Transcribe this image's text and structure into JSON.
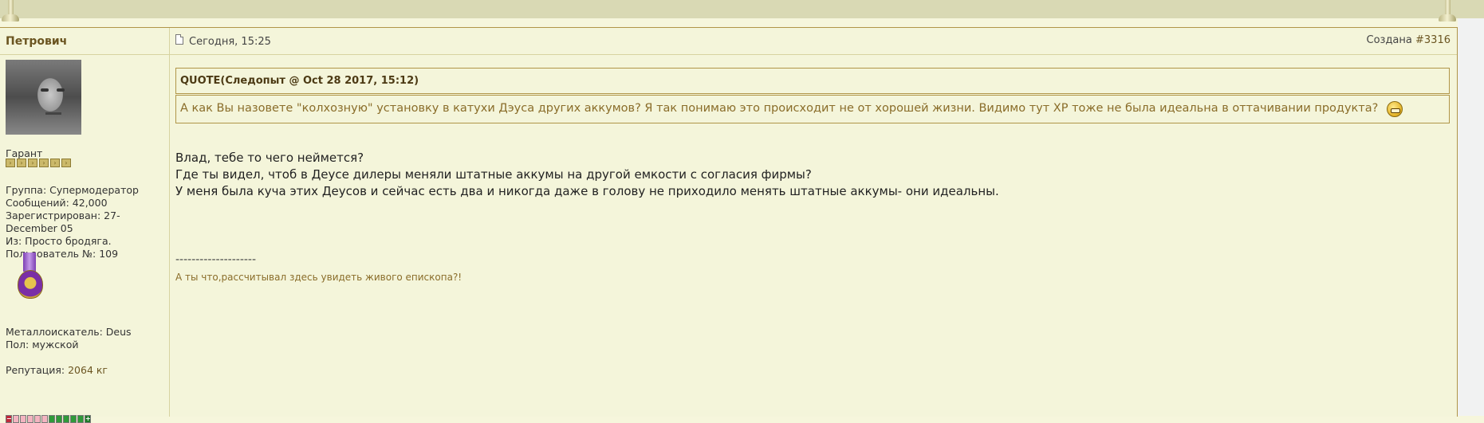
{
  "colors": {
    "background": "#f6f6dc",
    "border": "#b09548",
    "author_name": "#6b5521",
    "quote_text": "#8a6d2a"
  },
  "post": {
    "author": "Петрович",
    "date": "Сегодня, 15:25",
    "created_label": "Создана",
    "post_number": "#3316",
    "author_info": {
      "title": "Гарант",
      "group": "Группа: Супермодератор",
      "messages": "Сообщений: 42,000",
      "registered_line1": "Зарегистрирован: 27-",
      "registered_line2": "December 05",
      "from": "Из: Просто бродяга.",
      "user_number": "Пользователь №: 109",
      "metal_detector": "Металлоискатель: Deus",
      "gender": "Пол: мужской",
      "reputation_label": "Репутация:",
      "reputation_value": "2064 кг"
    },
    "quote": {
      "header": "QUOTE(Следопыт @ Oct 28 2017, 15:12)",
      "text": "А как Вы назовете \"колхозную\" установку в катухи Дэуса других аккумов? Я так понимаю это происходит не от хорошей жизни. Видимо тут ХР тоже не была идеальна в оттачивании продукта?"
    },
    "body_lines": [
      "Влад, тебе то чего неймется?",
      "Где ты видел, чтоб в Деусе дилеры меняли штатные аккумы на другой емкости с согласия фирмы?",
      "У меня была куча этих Деусов и сейчас есть два и никогда даже в голову не приходило менять штатные аккумы- они идеальны."
    ],
    "signature_separator": "--------------------",
    "signature": "А ты что,рассчитывал здесь увидеть живого епископа?!"
  }
}
